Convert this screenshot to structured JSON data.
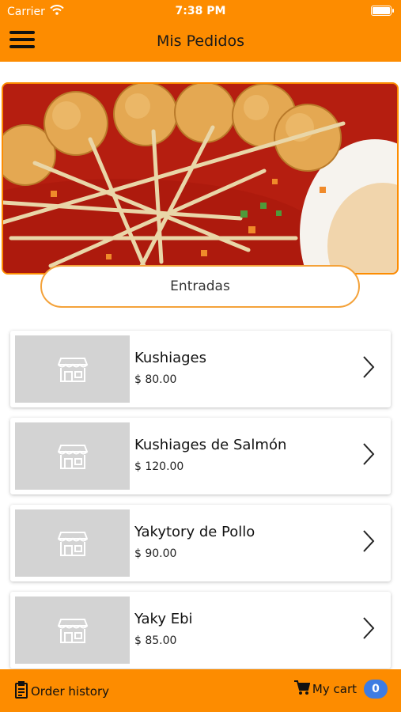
{
  "status": {
    "carrier": "Carrier",
    "time": "7:38 PM"
  },
  "header": {
    "title": "Mis Pedidos"
  },
  "category": {
    "label": "Entradas"
  },
  "products": [
    {
      "name": "Kushiages",
      "price": "$ 80.00"
    },
    {
      "name": "Kushiages de Salmón",
      "price": "$ 120.00"
    },
    {
      "name": "Yakytory de Pollo",
      "price": "$ 90.00"
    },
    {
      "name": "Yaky Ebi",
      "price": "$ 85.00"
    }
  ],
  "footer": {
    "order_history": "Order history",
    "cart": "My cart",
    "cart_count": "0"
  },
  "colors": {
    "accent": "#fd8c00",
    "badge": "#3e7ce2",
    "placeholder": "#d3d3d3"
  },
  "icons": [
    "wifi-icon",
    "battery-icon",
    "menu-icon",
    "store-icon",
    "chevron-right-icon",
    "clipboard-icon",
    "cart-icon"
  ]
}
